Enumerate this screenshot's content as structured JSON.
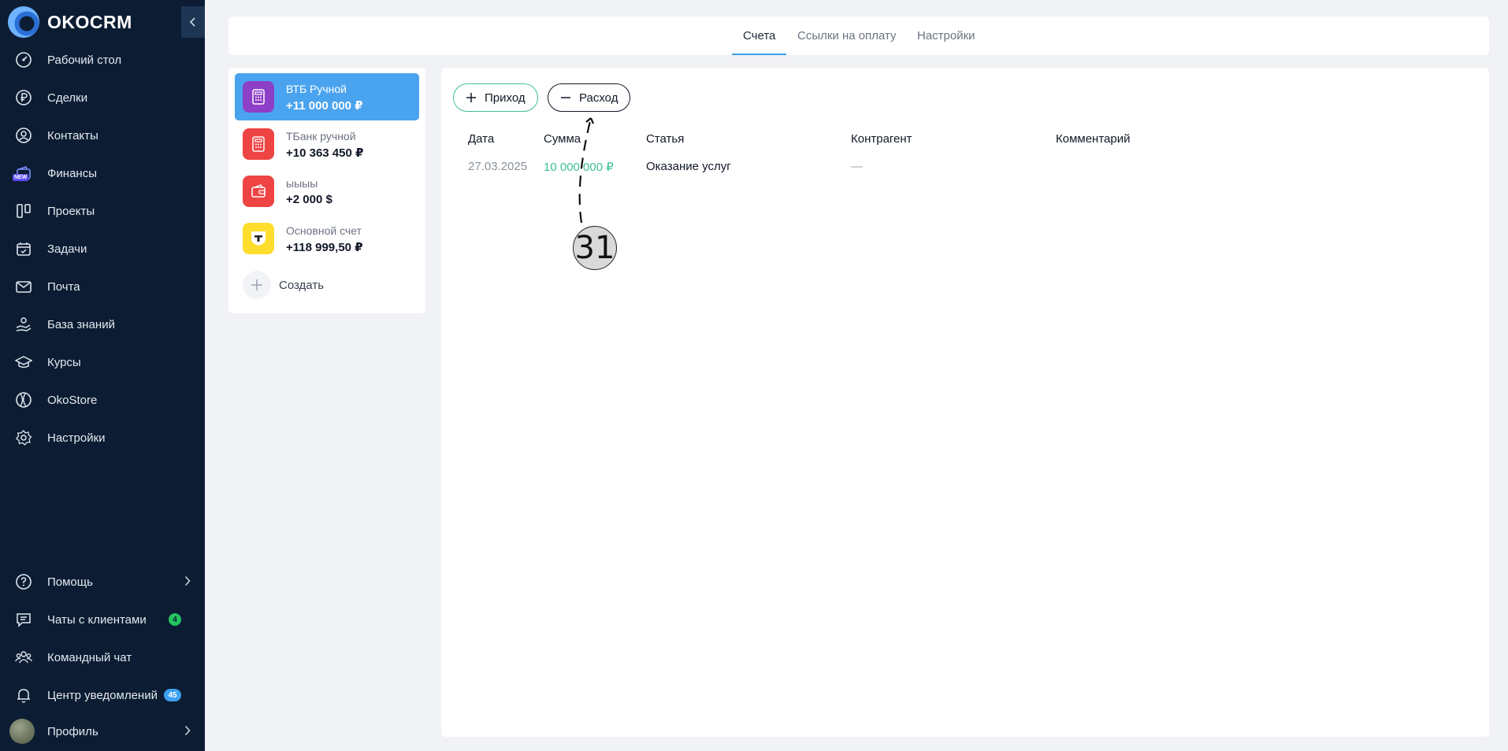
{
  "brand": {
    "name": "OKOCRM"
  },
  "sidebar": {
    "items": [
      {
        "label": "Рабочий стол",
        "icon": "dashboard-gauge-icon"
      },
      {
        "label": "Сделки",
        "icon": "ruble-coin-icon"
      },
      {
        "label": "Контакты",
        "icon": "user-circle-icon"
      },
      {
        "label": "Финансы",
        "icon": "wallet-icon",
        "tag": "NEW"
      },
      {
        "label": "Проекты",
        "icon": "kanban-columns-icon"
      },
      {
        "label": "Задачи",
        "icon": "calendar-check-icon"
      },
      {
        "label": "Почта",
        "icon": "envelope-icon"
      },
      {
        "label": "База знаний",
        "icon": "hand-knowledge-icon"
      },
      {
        "label": "Курсы",
        "icon": "graduation-cap-icon"
      },
      {
        "label": "OkoStore",
        "icon": "store-globe-icon"
      },
      {
        "label": "Настройки",
        "icon": "gear-icon"
      }
    ],
    "bottom": [
      {
        "label": "Помощь",
        "icon": "help-circle-icon"
      },
      {
        "label": "Чаты с клиентами",
        "icon": "chat-bubble-icon",
        "badge": "4"
      },
      {
        "label": "Командный чат",
        "icon": "team-users-icon"
      },
      {
        "label": "Центр уведомлений",
        "icon": "bell-icon",
        "badge": "45"
      },
      {
        "label": "Профиль",
        "icon": "avatar"
      }
    ]
  },
  "tabs": [
    {
      "label": "Счета",
      "active": true
    },
    {
      "label": "Ссылки на оплату",
      "active": false
    },
    {
      "label": "Настройки",
      "active": false
    }
  ],
  "accounts": [
    {
      "name": "ВТБ Ручной",
      "sum": "+11 000 000 ₽",
      "icon": "calculator-icon",
      "color": "#8e3fc8",
      "active": true
    },
    {
      "name": "ТБанк ручной",
      "sum": "+10 363 450 ₽",
      "icon": "calculator-icon",
      "color": "#ef4444",
      "active": false
    },
    {
      "name": "ыыыы",
      "sum": "+2 000 $",
      "icon": "wallet-cards-icon",
      "color": "#ef4444",
      "active": false
    },
    {
      "name": "Основной счет",
      "sum": "+118 999,50 ₽",
      "icon": "tbank-logo-icon",
      "color": "#ffdd2d",
      "active": false
    }
  ],
  "create_label": "Создать",
  "actions": {
    "income": "Приход",
    "expense": "Расход"
  },
  "table": {
    "headers": [
      "Дата",
      "Сумма",
      "Статья",
      "Контрагент",
      "Комментарий"
    ],
    "rows": [
      {
        "date": "27.03.2025",
        "sum": "10 000 000 ₽",
        "article": "Оказание услуг",
        "counterparty": "—",
        "comment": ""
      }
    ]
  },
  "colors": {
    "sidebar_bg": "#0c1d33",
    "accent": "#3ba1f0",
    "income_green": "#3cbf9a"
  },
  "annotation": {
    "number": "31"
  }
}
